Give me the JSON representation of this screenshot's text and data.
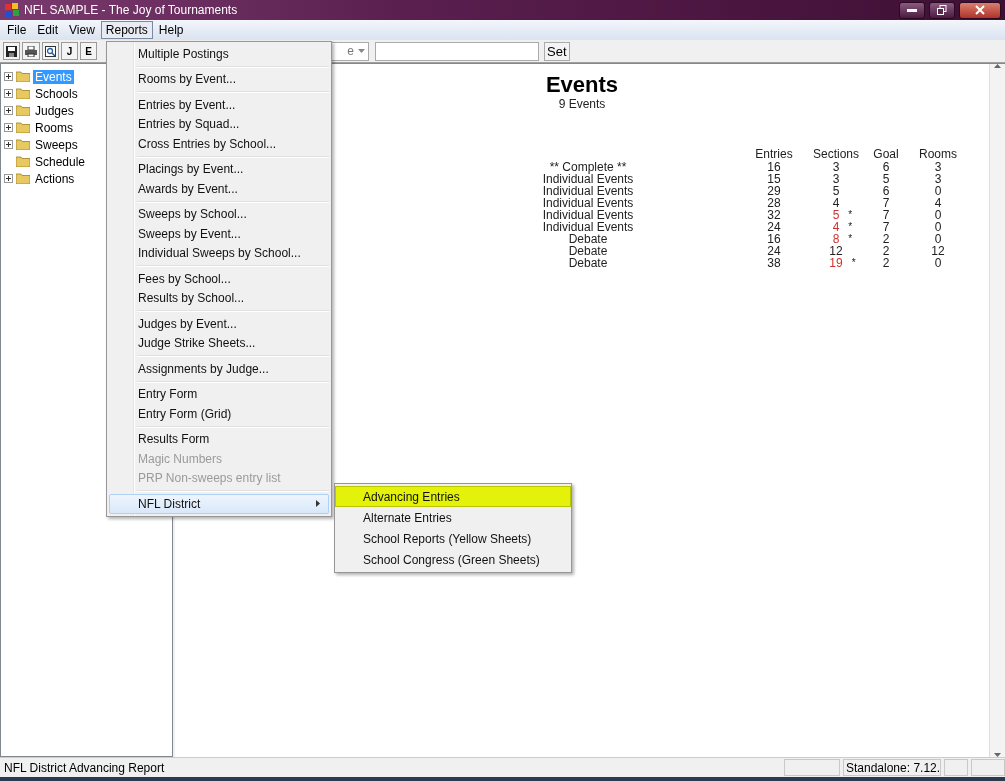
{
  "window": {
    "title": "NFL SAMPLE - The Joy of Tournaments"
  },
  "menu_bar": [
    {
      "label": "File",
      "selected": false
    },
    {
      "label": "Edit",
      "selected": false
    },
    {
      "label": "View",
      "selected": false
    },
    {
      "label": "Reports",
      "selected": true
    },
    {
      "label": "Help",
      "selected": false
    }
  ],
  "toolbar": {
    "letter_buttons": [
      "J",
      "E"
    ],
    "combo_value": "e",
    "set_button": "Set"
  },
  "tree": [
    {
      "label": "Events",
      "selected": true,
      "expandable": true
    },
    {
      "label": "Schools",
      "selected": false,
      "expandable": true
    },
    {
      "label": "Judges",
      "selected": false,
      "expandable": true
    },
    {
      "label": "Rooms",
      "selected": false,
      "expandable": true
    },
    {
      "label": "Sweeps",
      "selected": false,
      "expandable": true
    },
    {
      "label": "Schedule",
      "selected": false,
      "expandable": false
    },
    {
      "label": "Actions",
      "selected": false,
      "expandable": true
    }
  ],
  "report": {
    "title": "Events",
    "subtitle": "9 Events",
    "columns": [
      "Entries",
      "Sections",
      "Goal",
      "Rooms"
    ],
    "rows": [
      {
        "name": "** Complete **",
        "entries": "16",
        "sections": "3",
        "flagged": false,
        "goal": "6",
        "rooms": "3"
      },
      {
        "name": "Individual Events",
        "entries": "15",
        "sections": "3",
        "flagged": false,
        "goal": "5",
        "rooms": "3"
      },
      {
        "name": "Individual Events",
        "entries": "29",
        "sections": "5",
        "flagged": false,
        "goal": "6",
        "rooms": "0"
      },
      {
        "name": "Individual Events",
        "entries": "28",
        "sections": "4",
        "flagged": false,
        "goal": "7",
        "rooms": "4"
      },
      {
        "name": "Individual Events",
        "entries": "32",
        "sections": "5",
        "flagged": true,
        "note": "*",
        "goal": "7",
        "rooms": "0"
      },
      {
        "name": "Individual Events",
        "entries": "24",
        "sections": "4",
        "flagged": true,
        "note": "*",
        "goal": "7",
        "rooms": "0"
      },
      {
        "name": "Debate",
        "entries": "16",
        "sections": "8",
        "flagged": true,
        "note": "*",
        "goal": "2",
        "rooms": "0"
      },
      {
        "name": "Debate",
        "entries": "24",
        "sections": "12",
        "flagged": false,
        "goal": "2",
        "rooms": "12"
      },
      {
        "name": "Debate",
        "entries": "38",
        "sections": "19",
        "flagged": true,
        "note": "*",
        "goal": "2",
        "rooms": "0"
      }
    ]
  },
  "reports_menu": {
    "groups": [
      [
        {
          "label": "Multiple Postings",
          "disabled": false
        }
      ],
      [
        {
          "label": "Rooms by Event...",
          "disabled": false
        }
      ],
      [
        {
          "label": "Entries by Event...",
          "disabled": false
        },
        {
          "label": "Entries by Squad...",
          "disabled": false
        },
        {
          "label": "Cross Entries by School...",
          "disabled": false
        }
      ],
      [
        {
          "label": "Placings by Event...",
          "disabled": false
        },
        {
          "label": "Awards by Event...",
          "disabled": false
        }
      ],
      [
        {
          "label": "Sweeps by School...",
          "disabled": false
        },
        {
          "label": "Sweeps by Event...",
          "disabled": false
        },
        {
          "label": "Individual Sweeps by School...",
          "disabled": false
        }
      ],
      [
        {
          "label": "Fees by School...",
          "disabled": false
        },
        {
          "label": "Results by School...",
          "disabled": false
        }
      ],
      [
        {
          "label": "Judges by Event...",
          "disabled": false
        },
        {
          "label": "Judge Strike Sheets...",
          "disabled": false
        }
      ],
      [
        {
          "label": "Assignments by Judge...",
          "disabled": false
        }
      ],
      [
        {
          "label": "Entry Form",
          "disabled": false
        },
        {
          "label": "Entry Form (Grid)",
          "disabled": false
        }
      ],
      [
        {
          "label": "Results Form",
          "disabled": false
        },
        {
          "label": "Magic Numbers",
          "disabled": true
        },
        {
          "label": "PRP Non-sweeps entry list",
          "disabled": true
        }
      ],
      [
        {
          "label": "NFL District",
          "disabled": false,
          "has_submenu": true,
          "selected": true
        }
      ]
    ]
  },
  "submenu": [
    {
      "label": "Advancing Entries",
      "selected": true
    },
    {
      "label": "Alternate Entries",
      "selected": false
    },
    {
      "label": "School Reports (Yellow Sheets)",
      "selected": false
    },
    {
      "label": "School Congress (Green Sheets)",
      "selected": false
    }
  ],
  "status_bar": {
    "message": "NFL District Advancing Report",
    "version": "Standalone: 7.12."
  }
}
